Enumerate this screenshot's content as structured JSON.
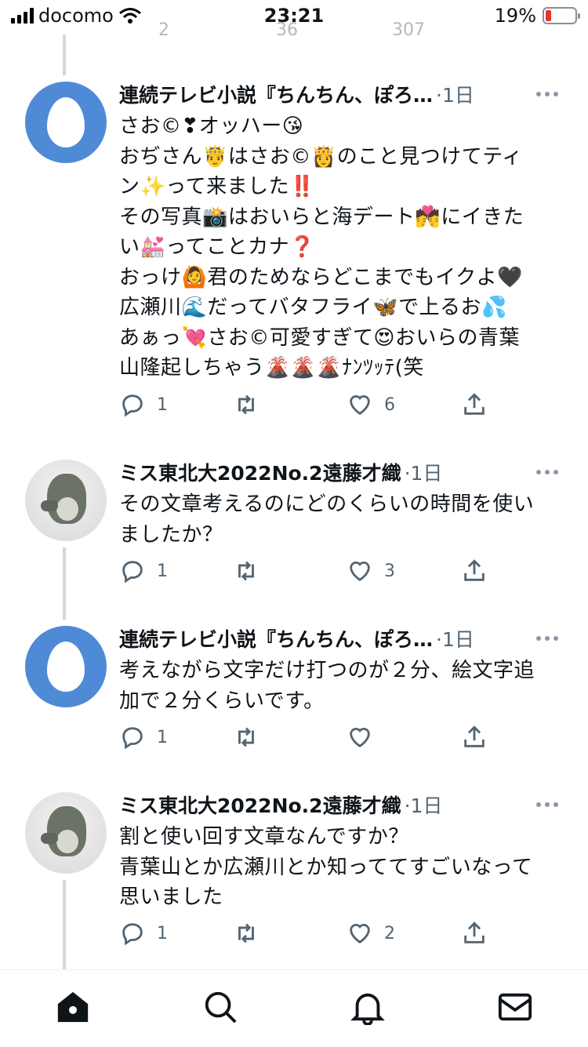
{
  "status_bar": {
    "carrier": "docomo",
    "time": "23:21",
    "battery": "19%",
    "battery_level": 0.19
  },
  "prev_tweet": {
    "replies": "2",
    "retweets": "36",
    "likes": "307"
  },
  "tweets": [
    {
      "name": "連続テレビ小説『ちんちん、ぽろ…",
      "time": "·1日",
      "text": "さお©︎❣オッハー😘\nおぢさん🤴はさお©︎👸のこと見つけてティ\nン✨って来ました‼️\nその写真📸はおいらと海デート💏にイきた\nい💒ってことカナ❓\nおっけ🙆君のためならどこまでもイクよ🖤\n広瀬川🌊だってバタフライ🦋で上るお💦\nあぁっ💘さお©︎可愛すぎて😍おいらの青葉\n山隆起しちゃう🌋🌋🌋ﾅﾝﾂｯﾃ(笑",
      "replies": "1",
      "retweets": "",
      "likes": "6"
    },
    {
      "name": "ミス東北大2022No.2遠藤才織",
      "time": "·1日",
      "text": "その文章考えるのにどのくらいの時間を使い\nましたか？",
      "replies": "1",
      "retweets": "",
      "likes": "3"
    },
    {
      "name": "連続テレビ小説『ちんちん、ぽろ…",
      "time": "·1日",
      "text": "考えながら文字だけ打つのが２分、絵文字追\n加で２分くらいです。",
      "replies": "1",
      "retweets": "",
      "likes": ""
    },
    {
      "name": "ミス東北大2022No.2遠藤才織",
      "time": "·1日",
      "text": "割と使い回す文章なんですか？\n青葉山とか広瀬川とか知っててすごいなって\n思いました",
      "replies": "1",
      "retweets": "",
      "likes": "2"
    }
  ],
  "tab_bar": {
    "items": [
      "home-icon",
      "search-icon",
      "notifications-icon",
      "messages-icon"
    ]
  }
}
